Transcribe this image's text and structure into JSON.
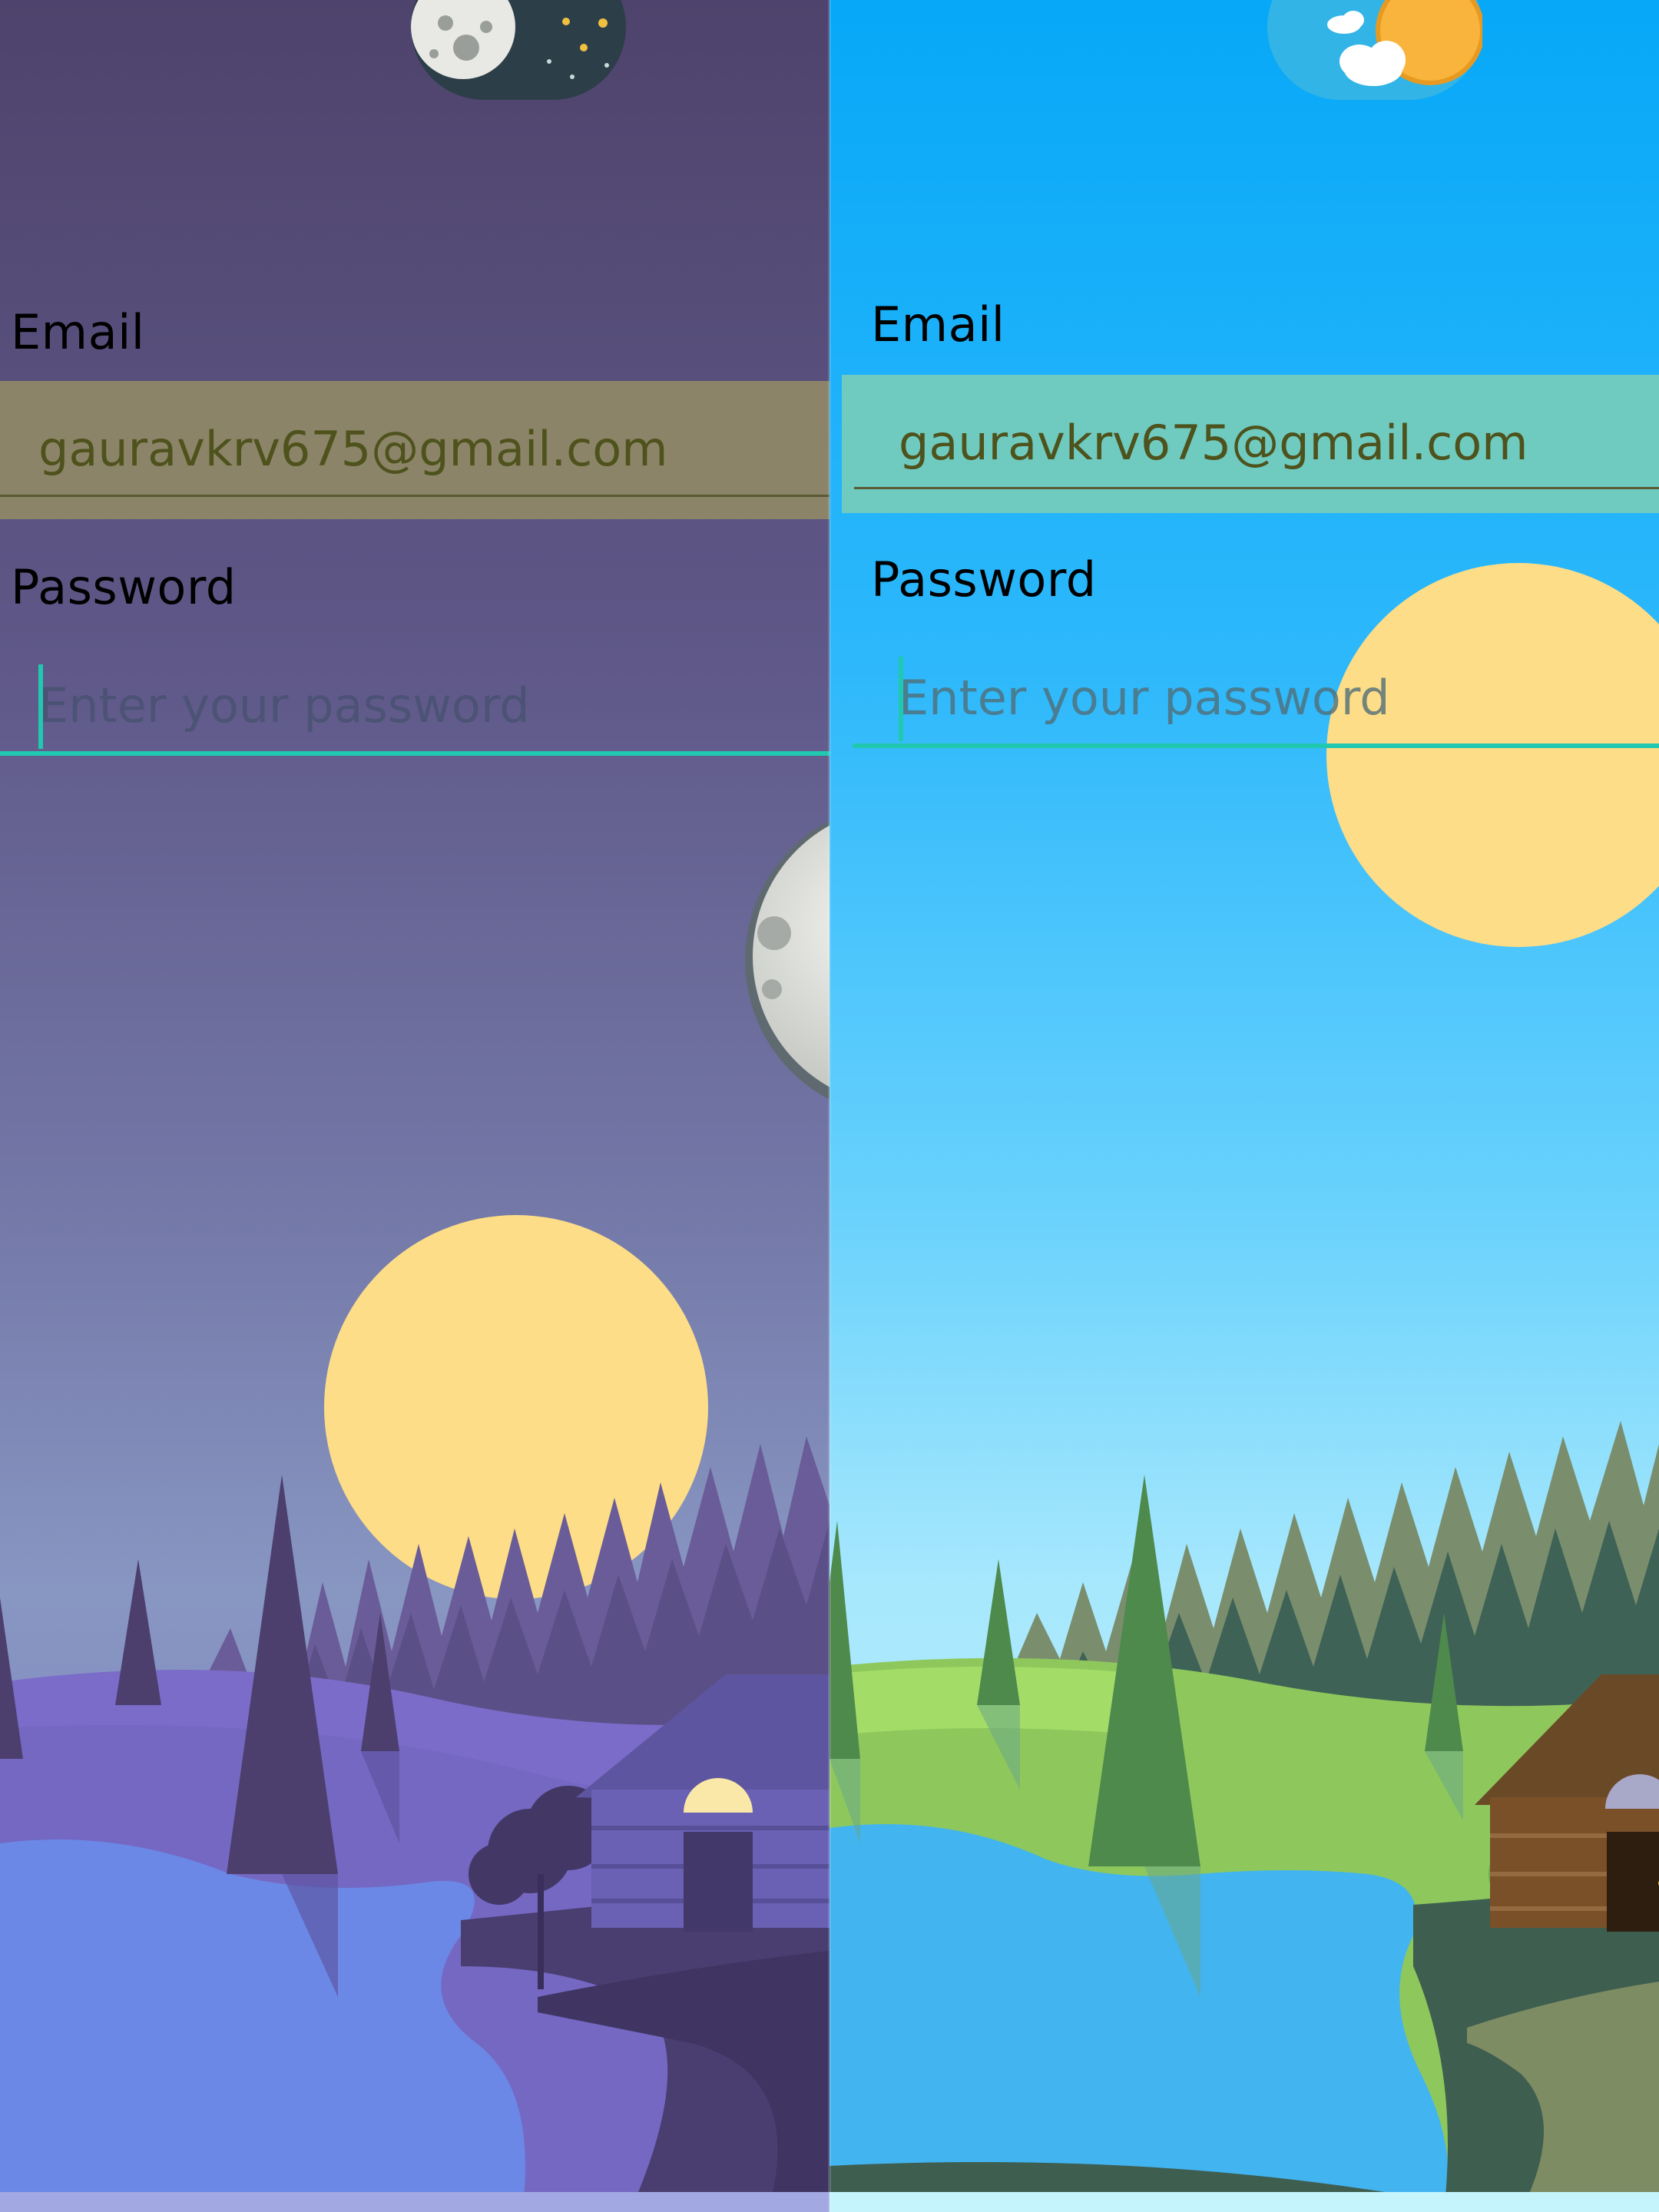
{
  "screens": {
    "night": {
      "theme_toggle": {
        "state": "night",
        "icons": [
          "moon-icon",
          "stars-icon"
        ]
      },
      "email": {
        "label": "Email",
        "value": "gauravkrv675@gmail.com"
      },
      "password": {
        "label": "Password",
        "placeholder": "Enter your password"
      }
    },
    "day": {
      "theme_toggle": {
        "state": "day",
        "icons": [
          "sun-icon",
          "cloud-icon"
        ]
      },
      "email": {
        "label": "Email",
        "value": "gauravkrv675@gmail.com"
      },
      "password": {
        "label": "Password",
        "placeholder": "Enter your password"
      }
    }
  },
  "colors": {
    "night_sky_top": "#4e436c",
    "day_sky_top": "#07a8f8",
    "accent_focus": "#20c8b0",
    "autofill_night": "#8c8468",
    "autofill_day": "#6fcbc0",
    "sun_disc": "#fddd87"
  }
}
